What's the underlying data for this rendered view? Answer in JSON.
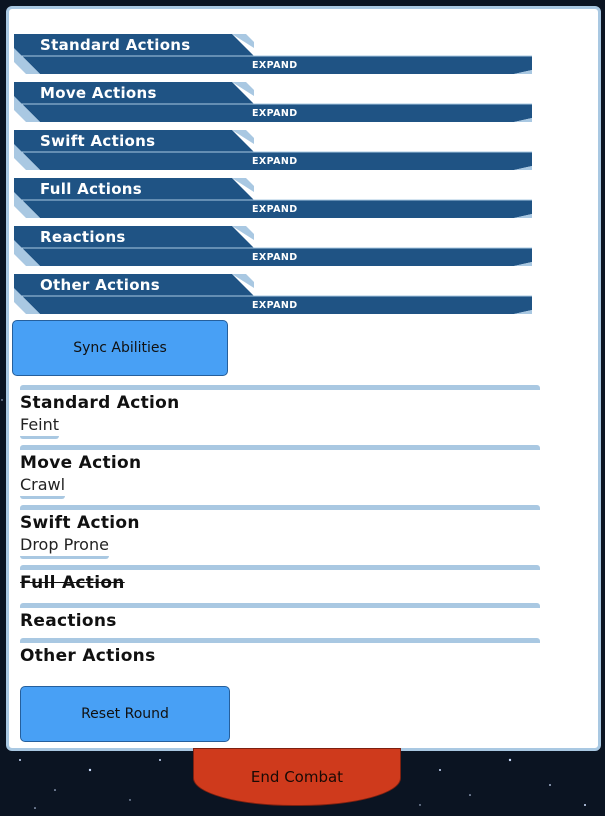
{
  "accordions": [
    {
      "title": "Standard Actions",
      "expand_label": "EXPAND"
    },
    {
      "title": "Move Actions",
      "expand_label": "EXPAND"
    },
    {
      "title": "Swift Actions",
      "expand_label": "EXPAND"
    },
    {
      "title": "Full Actions",
      "expand_label": "EXPAND"
    },
    {
      "title": "Reactions",
      "expand_label": "EXPAND"
    },
    {
      "title": "Other Actions",
      "expand_label": "EXPAND"
    }
  ],
  "sync_button": "Sync Abilities",
  "tracker": [
    {
      "label": "Standard Action",
      "value": "Feint",
      "used": false
    },
    {
      "label": "Move Action",
      "value": "Crawl",
      "used": false
    },
    {
      "label": "Swift Action",
      "value": "Drop Prone",
      "used": false
    },
    {
      "label": "Full Action",
      "value": "",
      "used": true
    },
    {
      "label": "Reactions",
      "value": "",
      "used": false
    },
    {
      "label": "Other Actions",
      "value": "",
      "used": false
    }
  ],
  "reset_button": "Reset Round",
  "end_combat_button": "End Combat",
  "colors": {
    "accordion_bar": "#1f5384",
    "accordion_accent": "#a9c8e2",
    "button_blue": "#48a0f5",
    "end_combat": "#cf3a1c"
  }
}
